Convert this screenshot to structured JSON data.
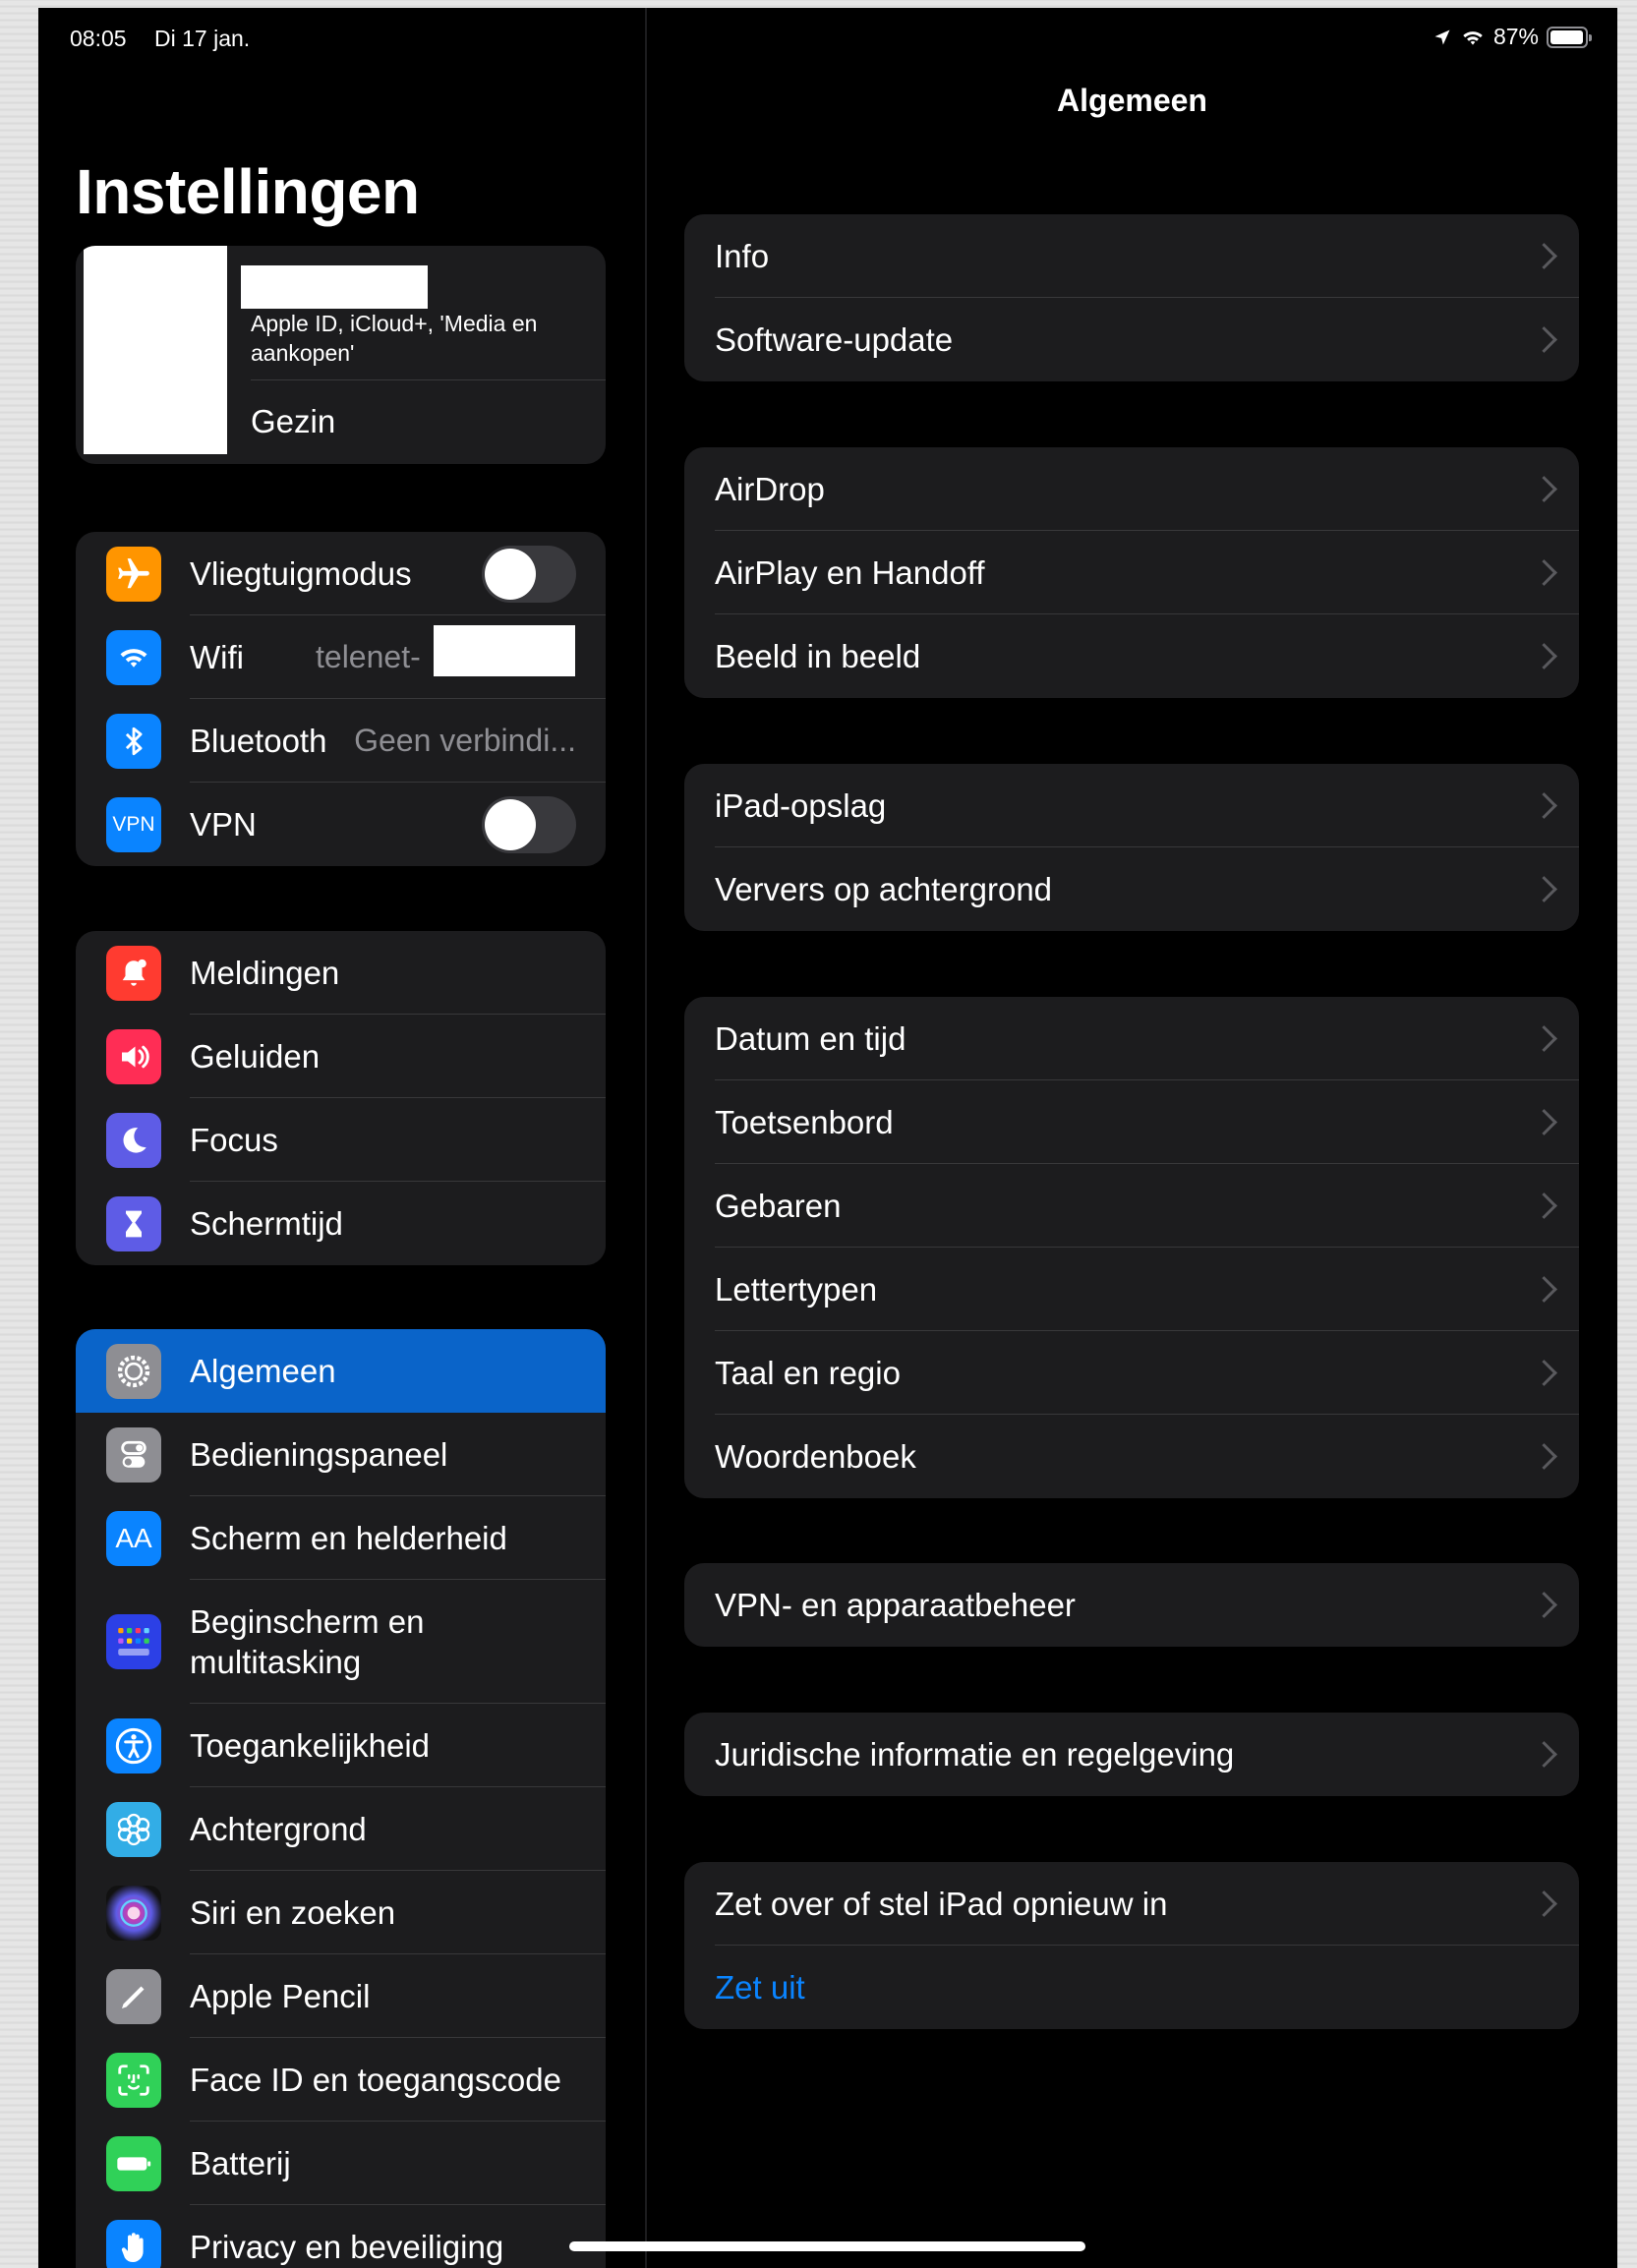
{
  "status": {
    "time": "08:05",
    "date": "Di 17 jan.",
    "battery": "87%",
    "battery_level": 0.87
  },
  "sidebar": {
    "title": "Instellingen",
    "profile": {
      "subtitle": "Apple ID, iCloud+, 'Media en aankopen'",
      "family": "Gezin"
    },
    "group1": [
      {
        "label": "Vliegtuigmodus",
        "icon": "airplane-icon",
        "color": "#ff9500",
        "toggle": false
      },
      {
        "label": "Wifi",
        "value": "telenet-",
        "icon": "wifi-icon",
        "color": "#0a84ff"
      },
      {
        "label": "Bluetooth",
        "value": "Geen verbindi...",
        "icon": "bluetooth-icon",
        "color": "#0a84ff"
      },
      {
        "label": "VPN",
        "icon": "vpn-icon",
        "icon_text": "VPN",
        "color": "#0a84ff",
        "toggle": false
      }
    ],
    "group2": [
      {
        "label": "Meldingen",
        "icon": "bell-icon",
        "color": "#ff3b30"
      },
      {
        "label": "Geluiden",
        "icon": "speaker-icon",
        "color": "#ff2d55"
      },
      {
        "label": "Focus",
        "icon": "moon-icon",
        "color": "#5e5ce6"
      },
      {
        "label": "Schermtijd",
        "icon": "hourglass-icon",
        "color": "#5e5ce6"
      }
    ],
    "group3": [
      {
        "label": "Algemeen",
        "icon": "gear-icon",
        "color": "#8e8e93",
        "selected": true
      },
      {
        "label": "Bedieningspaneel",
        "icon": "switches-icon",
        "color": "#8e8e93"
      },
      {
        "label": "Scherm en helderheid",
        "icon": "text-size-icon",
        "icon_text": "AA",
        "color": "#0a84ff"
      },
      {
        "label": "Beginscherm en multitasking",
        "icon": "grid-icon",
        "color": "#2c40e6"
      },
      {
        "label": "Toegankelijkheid",
        "icon": "accessibility-icon",
        "color": "#0a84ff"
      },
      {
        "label": "Achtergrond",
        "icon": "flower-icon",
        "color": "#32ade6"
      },
      {
        "label": "Siri en zoeken",
        "icon": "siri-icon",
        "color": "#1c1c1e"
      },
      {
        "label": "Apple Pencil",
        "icon": "pencil-icon",
        "color": "#8e8e93"
      },
      {
        "label": "Face ID en toegangscode",
        "icon": "face-id-icon",
        "color": "#30d158"
      },
      {
        "label": "Batterij",
        "icon": "battery-icon",
        "color": "#30d158"
      },
      {
        "label": "Privacy en beveiliging",
        "icon": "hand-icon",
        "color": "#0a84ff"
      }
    ]
  },
  "detail": {
    "title": "Algemeen",
    "groups": [
      [
        "Info",
        "Software-update"
      ],
      [
        "AirDrop",
        "AirPlay en Handoff",
        "Beeld in beeld"
      ],
      [
        "iPad-opslag",
        "Ververs op achtergrond"
      ],
      [
        "Datum en tijd",
        "Toetsenbord",
        "Gebaren",
        "Lettertypen",
        "Taal en regio",
        "Woordenboek"
      ],
      [
        "VPN- en apparaatbeheer"
      ],
      [
        "Juridische informatie en regelgeving"
      ],
      [
        "Zet over of stel iPad opnieuw in"
      ]
    ],
    "shutdown": "Zet uit",
    "accent": "#0a84ff"
  }
}
